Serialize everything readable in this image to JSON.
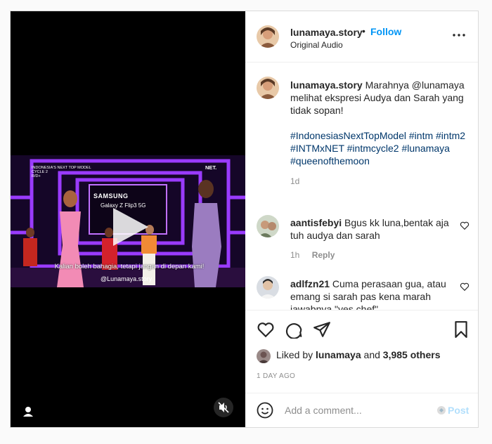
{
  "video": {
    "subtitle": "Kalian boleh bahagia, tetapi jangan di depan kami!",
    "watermark": "@Lunamaya.story",
    "show_title_line1": "INDONESIA'S NEXT TOP MODEL",
    "show_title_line2": "CYCLE 2",
    "show_title_line3": "R/D+",
    "network_logo": "NET.",
    "sponsor_line1": "SAMSUNG",
    "sponsor_line2": "Galaxy Z Flip3 5G"
  },
  "header": {
    "username": "lunamaya.story",
    "separator": "•",
    "follow_label": "Follow",
    "audio": "Original Audio"
  },
  "caption": {
    "username": "lunamaya.story",
    "text_line1": "Marahnya @lunamaya melihat ekspresi Audya dan Sarah yang tidak sopan!",
    "hashtags": "#IndonesiasNextTopModel #intm #intm2 #INTMxNET #intmcycle2 #lunamaya #queenofthemoon",
    "time": "1d"
  },
  "comments": [
    {
      "username": "aantisfebyi",
      "text": "Bgus kk luna,bentak aja tuh audya dan sarah",
      "time": "1h",
      "reply_label": "Reply"
    },
    {
      "username": "adlfzn21",
      "text": "Cuma perasaan gua, atau emang si sarah pas kena marah jawabnya \"yes chef\""
    }
  ],
  "likes": {
    "prefix": "Liked by",
    "user": "lunamaya",
    "and": "and",
    "others": "3,985 others"
  },
  "date": "1 DAY AGO",
  "add_comment": {
    "placeholder": "Add a comment...",
    "post_label": "Post"
  },
  "colors": {
    "follow_blue": "#0095f6",
    "post_disabled": "#b2dffc",
    "hashtag": "#00376b",
    "muted": "#8e8e8e",
    "stage_purple": "#9a3bff"
  }
}
